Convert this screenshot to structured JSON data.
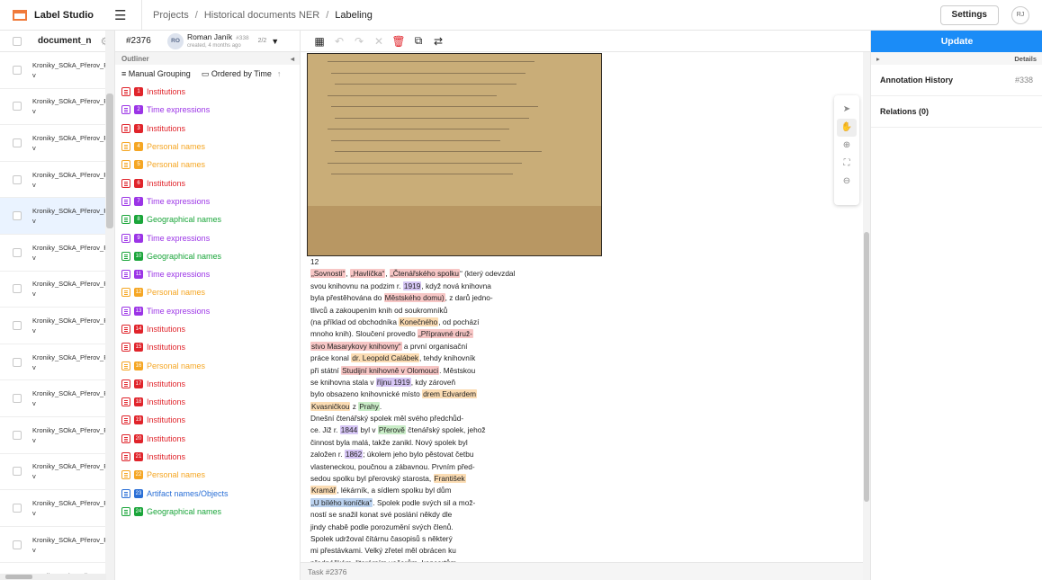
{
  "app": {
    "name": "Label Studio"
  },
  "breadcrumbs": [
    "Projects",
    "Historical documents NER",
    "Labeling"
  ],
  "header": {
    "settings_label": "Settings",
    "user_initials": "RJ"
  },
  "tasklist": {
    "column_label": "document_n",
    "rows": [
      "Kroniky_SOkA_Přerov_Př\nv",
      "Kroniky_SOkA_Přerov_Př\nv",
      "Kroniky_SOkA_Přerov_Př\nv",
      "Kroniky_SOkA_Přerov_Př\nv",
      "Kroniky_SOkA_Přerov_Př\nv",
      "Kroniky_SOkA_Přerov_Př\nv",
      "Kroniky_SOkA_Přerov_Př\nv",
      "Kroniky_SOkA_Přerov_Př\nv",
      "Kroniky_SOkA_Přerov_Př\nv",
      "Kroniky_SOkA_Přerov_Př\nv",
      "Kroniky_SOkA_Přerov_Př\nv",
      "Kroniky_SOkA_Přerov_Př\nv",
      "Kroniky_SOkA_Přerov_Př\nv",
      "Kroniky_SOkA_Přerov_Př\nv",
      "Kroniky_SOkA_Přerov_Př\nv"
    ],
    "selected_index": 4
  },
  "annotation": {
    "task_id": "#2376",
    "user_initials": "RO",
    "user_name": "Roman Janík",
    "annotation_id": "#338",
    "created": "created, 4 months ago",
    "count": "2/2"
  },
  "outliner": {
    "title": "Outliner",
    "grouping_label": "Manual Grouping",
    "order_label": "Ordered by Time",
    "regions": [
      {
        "n": "1",
        "label": "Institutions",
        "color": "#e0242b"
      },
      {
        "n": "2",
        "label": "Time expressions",
        "color": "#9b34e6"
      },
      {
        "n": "3",
        "label": "Institutions",
        "color": "#e0242b"
      },
      {
        "n": "4",
        "label": "Personal names",
        "color": "#f5a623"
      },
      {
        "n": "5",
        "label": "Personal names",
        "color": "#f5a623"
      },
      {
        "n": "6",
        "label": "Institutions",
        "color": "#e0242b"
      },
      {
        "n": "7",
        "label": "Time expressions",
        "color": "#9b34e6"
      },
      {
        "n": "8",
        "label": "Geographical names",
        "color": "#1aa53a"
      },
      {
        "n": "9",
        "label": "Time expressions",
        "color": "#9b34e6"
      },
      {
        "n": "10",
        "label": "Geographical names",
        "color": "#1aa53a"
      },
      {
        "n": "11",
        "label": "Time expressions",
        "color": "#9b34e6"
      },
      {
        "n": "12",
        "label": "Personal names",
        "color": "#f5a623"
      },
      {
        "n": "13",
        "label": "Time expressions",
        "color": "#9b34e6"
      },
      {
        "n": "14",
        "label": "Institutions",
        "color": "#e0242b"
      },
      {
        "n": "15",
        "label": "Institutions",
        "color": "#e0242b"
      },
      {
        "n": "16",
        "label": "Personal names",
        "color": "#f5a623"
      },
      {
        "n": "17",
        "label": "Institutions",
        "color": "#e0242b"
      },
      {
        "n": "18",
        "label": "Institutions",
        "color": "#e0242b"
      },
      {
        "n": "19",
        "label": "Institutions",
        "color": "#e0242b"
      },
      {
        "n": "20",
        "label": "Institutions",
        "color": "#e0242b"
      },
      {
        "n": "21",
        "label": "Institutions",
        "color": "#e0242b"
      },
      {
        "n": "22",
        "label": "Personal names",
        "color": "#f5a623"
      },
      {
        "n": "23",
        "label": "Artifact names/Objects",
        "color": "#2a6fd6"
      },
      {
        "n": "24",
        "label": "Geographical names",
        "color": "#1aa53a"
      }
    ]
  },
  "document": {
    "page_number": "12",
    "lines": [
      [
        {
          "t": "„Sovnosti“",
          "c": "inst"
        },
        {
          "t": ", "
        },
        {
          "t": "„Havlíčka“",
          "c": "inst"
        },
        {
          "t": ", "
        },
        {
          "t": "„Čtenářského spolku",
          "c": "inst"
        },
        {
          "t": "“ (který odevzdal"
        }
      ],
      [
        {
          "t": "svou knihovnu na podzim r. "
        },
        {
          "t": "1919",
          "c": "time"
        },
        {
          "t": ", když nová knihovna"
        }
      ],
      [
        {
          "t": "byla přestěhována do "
        },
        {
          "t": "Městského domu)",
          "c": "inst"
        },
        {
          "t": ", z darů jedno-"
        }
      ],
      [
        {
          "t": "tlivců a zakoupením knih od soukromníků"
        }
      ],
      [
        {
          "t": "(na příklad od obchodníka "
        },
        {
          "t": "Konečného",
          "c": "pers"
        },
        {
          "t": ", od pochází"
        }
      ],
      [
        {
          "t": "mnoho knih). Sloučení provedlo "
        },
        {
          "t": "„Přípravné druž-",
          "c": "inst"
        }
      ],
      [
        {
          "t": "stvo Masarykovy knihovny“",
          "c": "inst"
        },
        {
          "t": " a první organisační"
        }
      ],
      [
        {
          "t": "práce konal "
        },
        {
          "t": "dr. Leopold Calábek",
          "c": "pers"
        },
        {
          "t": ", tehdy knihovník"
        }
      ],
      [
        {
          "t": "při státní "
        },
        {
          "t": "Studijní knihovně v Olomouci",
          "c": "inst"
        },
        {
          "t": ". Městskou"
        }
      ],
      [
        {
          "t": "se knihovna stala v "
        },
        {
          "t": "říjnu 1919",
          "c": "time"
        },
        {
          "t": ", kdy zároveň"
        }
      ],
      [
        {
          "t": "bylo obsazeno knihovnické místo "
        },
        {
          "t": "drem Edvardem",
          "c": "pers"
        }
      ],
      [
        {
          "t": "Kvasničkou",
          "c": "pers"
        },
        {
          "t": " z "
        },
        {
          "t": "Prahy",
          "c": "geo"
        },
        {
          "t": "."
        }
      ],
      [
        {
          "t": "Dnešní čtenářský spolek měl svého předchůd-"
        }
      ],
      [
        {
          "t": "ce. Již r. "
        },
        {
          "t": "1844",
          "c": "time"
        },
        {
          "t": " byl v "
        },
        {
          "t": "Přerově",
          "c": "geo"
        },
        {
          "t": " čtenářský spolek, jehož"
        }
      ],
      [
        {
          "t": "činnost byla malá, takže zanikl. Nový spolek byl"
        }
      ],
      [
        {
          "t": "založen r. "
        },
        {
          "t": "1862",
          "c": "time"
        },
        {
          "t": "; úkolem jeho bylo pěstovat četbu"
        }
      ],
      [
        {
          "t": "vlasteneckou, poučnou a zábavnou. Prvním před-"
        }
      ],
      [
        {
          "t": "sedou spolku byl přerovský starosta, "
        },
        {
          "t": "František",
          "c": "pers"
        }
      ],
      [
        {
          "t": "Kramář",
          "c": "pers"
        },
        {
          "t": ", lékárník, a sídlem spolku byl dům"
        }
      ],
      [
        {
          "t": "„U bílého koníčka“",
          "c": "art"
        },
        {
          "t": ". Spolek podle svých sil a mož-"
        }
      ],
      [
        {
          "t": "ností se snažil konat své poslání někdy dle"
        }
      ],
      [
        {
          "t": "jindy chabě podle porozumění svých členů."
        }
      ],
      [
        {
          "t": "Spolek udržoval čítárnu časopisů s některý"
        }
      ],
      [
        {
          "t": "mi přestávkami. Velký zřetel měl obrácen ku"
        }
      ],
      [
        {
          "t": "přednáškám, literárním večerům, koncertům,"
        }
      ]
    ]
  },
  "footer": {
    "task_label": "Task #2376"
  },
  "right_panel": {
    "update_label": "Update",
    "details_label": "Details",
    "history_label": "Annotation History",
    "history_id": "#338",
    "relations_label": "Relations (0)"
  }
}
